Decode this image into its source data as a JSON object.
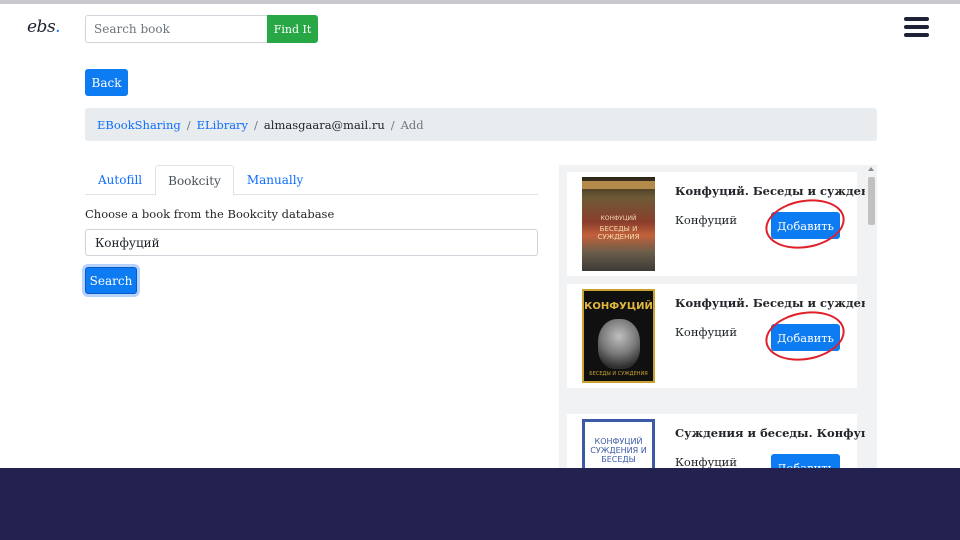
{
  "header": {
    "logo_text": "ebs",
    "logo_dot": ".",
    "search_placeholder": "Search book",
    "find_label": "Find It"
  },
  "nav": {
    "back_label": "Back"
  },
  "breadcrumb": {
    "items": [
      "EBookSharing",
      "ELibrary",
      "almasgaara@mail.ru",
      "Add"
    ]
  },
  "tabs": [
    {
      "label": "Autofill",
      "active": false
    },
    {
      "label": "Bookcity",
      "active": true
    },
    {
      "label": "Manually",
      "active": false
    }
  ],
  "form": {
    "label": "Choose a book from the Bookcity database",
    "query_value": "Конфуций",
    "search_label": "Search"
  },
  "results": [
    {
      "title": "Конфуций. Беседы и суждения",
      "author": "Конфуций",
      "add_label": "Добавить",
      "cover_text": "БЕСЕДЫ И СУЖДЕНИЯ",
      "cover_sub": "КОНФУЦИЙ"
    },
    {
      "title": "Конфуций. Беседы и суждения",
      "author": "Конфуций",
      "add_label": "Добавить",
      "cover_text": "КОНФУЦИЙ",
      "cover_sub": "БЕСЕДЫ И СУЖДЕНИЯ"
    },
    {
      "title": "Суждения и беседы. Конфуций",
      "author": "Конфуций",
      "add_label": "Добавить",
      "cover_text": "КОНФУЦИЙ СУЖДЕНИЯ И БЕСЕДЫ"
    }
  ],
  "colors": {
    "primary": "#0d7bf2",
    "success": "#28a745",
    "annotation": "#e0202a",
    "footer": "#222150"
  }
}
